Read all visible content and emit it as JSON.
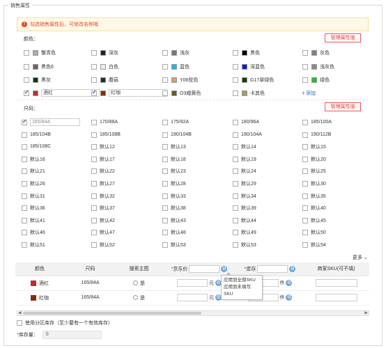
{
  "section_title": "销售属性",
  "alert_text": "勾选销售属性后，可修改名称哦",
  "color": {
    "label": "颜色：",
    "manage_label": "管理属性值",
    "add_label": "添加",
    "items": [
      {
        "label": "蟹青色",
        "swatch": "#aaaaaa",
        "checked": false
      },
      {
        "label": "深灰",
        "swatch": "#222222",
        "checked": false
      },
      {
        "label": "浅灰",
        "swatch": "#777777",
        "checked": false
      },
      {
        "label": "黑色",
        "swatch": "#000000",
        "checked": false
      },
      {
        "label": "灰色",
        "swatch": "#808080",
        "checked": false
      },
      {
        "label": "黑色6",
        "swatch": "#666666",
        "checked": false
      },
      {
        "label": "白色",
        "swatch": "#eeeeee",
        "checked": false
      },
      {
        "label": "蓝色",
        "swatch": "#2ab0e8",
        "checked": false
      },
      {
        "label": "深蓝色",
        "swatch": "#0a1cd6",
        "checked": false
      },
      {
        "label": "浅灰色",
        "swatch": "#8a8a8a",
        "checked": false
      },
      {
        "label": "黑灰",
        "swatch": "#0a3a0a",
        "checked": false
      },
      {
        "label": "蘑菇",
        "swatch": "#2a2a2a",
        "checked": false
      },
      {
        "label": "Y06驼色",
        "swatch": "#c9a275",
        "checked": false
      },
      {
        "label": "G17翠绿色",
        "swatch": "#123c12",
        "checked": false
      },
      {
        "label": "绿色",
        "swatch": "#22c022",
        "checked": false
      },
      {
        "label": "酒红",
        "swatch": "#c52a2a",
        "checked": true,
        "input": true
      },
      {
        "label": "红咖",
        "swatch": "#8a2b0e",
        "checked": true,
        "input": true
      },
      {
        "label": "O3威黄色",
        "swatch": "#6a5a2a",
        "checked": false
      },
      {
        "label": "卡其色",
        "swatch": "#a89a62",
        "checked": false
      }
    ]
  },
  "size": {
    "label": "尺码：",
    "manage_label": "管理属性值",
    "items": [
      {
        "label": "165/84A",
        "checked": true,
        "input": true
      },
      {
        "label": "170/88A"
      },
      {
        "label": "175/92A"
      },
      {
        "label": "180/96A"
      },
      {
        "label": "185/100A"
      },
      {
        "label": "185/104B"
      },
      {
        "label": "185/108B"
      },
      {
        "label": "190/104B"
      },
      {
        "label": "190/104A"
      },
      {
        "label": "190/112B"
      },
      {
        "label": "185/108C"
      },
      {
        "label": "默认12"
      },
      {
        "label": "默认13"
      },
      {
        "label": "默认14"
      },
      {
        "label": "默认15"
      },
      {
        "label": "默认16"
      },
      {
        "label": "默认17"
      },
      {
        "label": "默认18"
      },
      {
        "label": "默认19"
      },
      {
        "label": "默认20"
      },
      {
        "label": "默认21"
      },
      {
        "label": "默认22"
      },
      {
        "label": "默认23"
      },
      {
        "label": "默认24"
      },
      {
        "label": "默认25"
      },
      {
        "label": "默认26"
      },
      {
        "label": "默认27"
      },
      {
        "label": "默认28"
      },
      {
        "label": "默认29"
      },
      {
        "label": "默认30"
      },
      {
        "label": "默认31"
      },
      {
        "label": "默认32"
      },
      {
        "label": "默认33"
      },
      {
        "label": "默认34"
      },
      {
        "label": "默认35"
      },
      {
        "label": "默认36"
      },
      {
        "label": "默认37"
      },
      {
        "label": "默认38"
      },
      {
        "label": "默认39"
      },
      {
        "label": "默认40"
      },
      {
        "label": "默认41"
      },
      {
        "label": "默认42"
      },
      {
        "label": "默认43"
      },
      {
        "label": "默认44"
      },
      {
        "label": "默认45"
      },
      {
        "label": "默认46"
      },
      {
        "label": "默认47"
      },
      {
        "label": "默认48"
      },
      {
        "label": "默认49"
      },
      {
        "label": "默认50"
      },
      {
        "label": "默认51"
      },
      {
        "label": "默认52"
      },
      {
        "label": "默认53"
      },
      {
        "label": "默认53"
      },
      {
        "label": "默认54"
      }
    ]
  },
  "more_label": "更多",
  "table": {
    "headers": {
      "color": "颜色",
      "size": "尺码",
      "main_image": "搜索主图",
      "price": "京东价",
      "stock": "库存",
      "sku": "商家SKU(可不填)"
    },
    "yes_label": "是",
    "yuan_label": "元",
    "piece_label": "件",
    "rows": [
      {
        "color": "酒红",
        "swatch": "#c52a2a",
        "size": "165/84A"
      },
      {
        "color": "红咖",
        "swatch": "#8a2b0e",
        "size": "165/84A"
      }
    ]
  },
  "popup": {
    "apply_all": "应用到全部SKU",
    "apply_empty": "应用到未填写SKU"
  },
  "region_stock_label": "使用分区库存（至少要有一个有效库存）",
  "stock_total": {
    "label": "库存量：",
    "value": "0"
  }
}
